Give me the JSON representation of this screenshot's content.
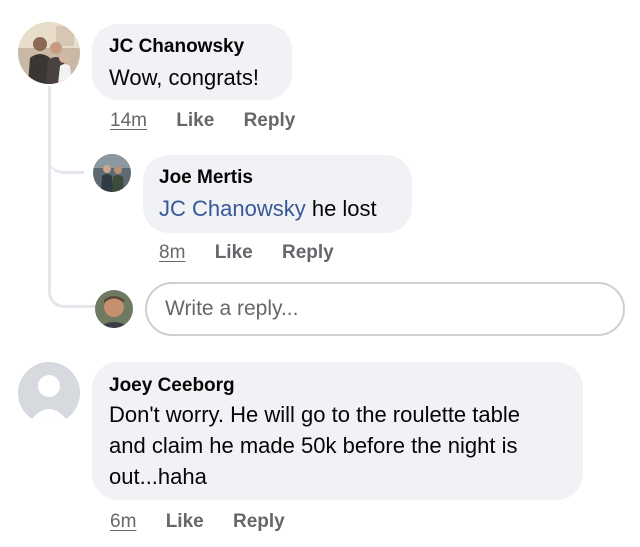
{
  "comments": [
    {
      "author": "JC Chanowsky",
      "text": "Wow, congrats!",
      "time": "14m",
      "like": "Like",
      "reply": "Reply",
      "avatar_icon": "profile-photo-icon"
    },
    {
      "author": "Joe Mertis",
      "mention": "JC Chanowsky",
      "text": " he lost",
      "time": "8m",
      "like": "Like",
      "reply": "Reply",
      "avatar_icon": "profile-photo-icon"
    },
    {
      "author": "Joey Ceeborg",
      "text_lines": [
        "Don't worry. He will go to the roulette table",
        "and claim he made 50k before the night is",
        "out...haha"
      ],
      "time": "6m",
      "like": "Like",
      "reply": "Reply",
      "avatar_icon": "default-avatar-icon"
    }
  ],
  "reply_box": {
    "placeholder": "Write a reply...",
    "avatar_icon": "profile-photo-icon"
  },
  "colors": {
    "bubble": "#f0f2f5",
    "meta_text": "#65676b",
    "mention": "#385898",
    "thread_line": "#e4e6eb"
  }
}
